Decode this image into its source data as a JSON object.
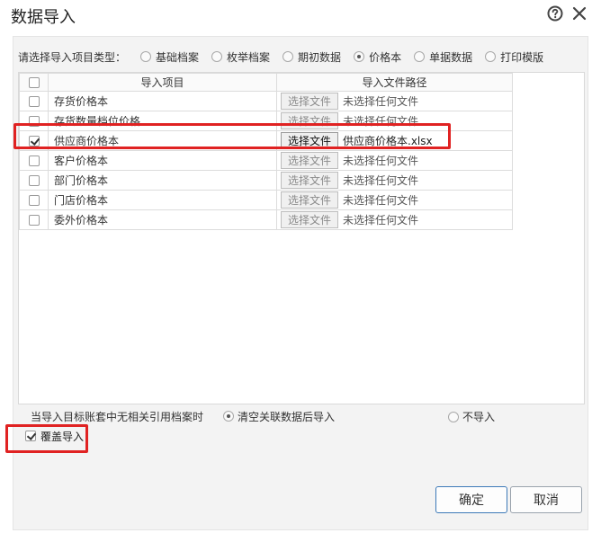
{
  "dialog": {
    "title": "数据导入"
  },
  "import_type": {
    "label": "请选择导入项目类型：",
    "options": [
      {
        "label": "基础档案",
        "selected": false
      },
      {
        "label": "枚举档案",
        "selected": false
      },
      {
        "label": "期初数据",
        "selected": false
      },
      {
        "label": "价格本",
        "selected": true
      },
      {
        "label": "单据数据",
        "selected": false
      },
      {
        "label": "打印模版",
        "selected": false
      }
    ]
  },
  "table": {
    "headers": {
      "item": "导入项目",
      "path": "导入文件路径"
    },
    "rows": [
      {
        "name": "存货价格本",
        "checked": false,
        "button": "选择文件",
        "file": "未选择任何文件"
      },
      {
        "name": "存货数量档位价格",
        "checked": false,
        "button": "选择文件",
        "file": "未选择任何文件"
      },
      {
        "name": "供应商价格本",
        "checked": true,
        "button": "选择文件",
        "file": "供应商价格本.xlsx"
      },
      {
        "name": "客户价格本",
        "checked": false,
        "button": "选择文件",
        "file": "未选择任何文件"
      },
      {
        "name": "部门价格本",
        "checked": false,
        "button": "选择文件",
        "file": "未选择任何文件"
      },
      {
        "name": "门店价格本",
        "checked": false,
        "button": "选择文件",
        "file": "未选择任何文件"
      },
      {
        "name": "委外价格本",
        "checked": false,
        "button": "选择文件",
        "file": "未选择任何文件"
      }
    ]
  },
  "missing_archive": {
    "label": "当导入目标账套中无相关引用档案时",
    "options": [
      {
        "label": "清空关联数据后导入",
        "selected": true
      },
      {
        "label": "不导入",
        "selected": false
      }
    ]
  },
  "cover": {
    "label": "覆盖导入",
    "checked": true
  },
  "buttons": {
    "ok": "确定",
    "cancel": "取消"
  },
  "icons": {
    "help": "help-circle-icon",
    "close": "close-icon"
  },
  "colors": {
    "highlight": "#e02222",
    "ok_border": "#3d7ab8"
  }
}
